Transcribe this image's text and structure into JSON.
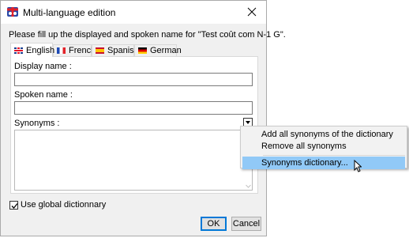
{
  "window": {
    "title": "Multi-language edition",
    "instruction": "Please fill up the displayed and spoken name for \"Test coût com N-1 G\"."
  },
  "tabs": [
    {
      "label": "English",
      "flag": "uk",
      "active": true
    },
    {
      "label": "French",
      "flag": "fr",
      "active": false
    },
    {
      "label": "Spanish",
      "flag": "es",
      "active": false
    },
    {
      "label": "German",
      "flag": "de",
      "active": false
    }
  ],
  "form": {
    "display_name_label": "Display name :",
    "display_name_value": "",
    "spoken_name_label": "Spoken name :",
    "spoken_name_value": "",
    "synonyms_label": "Synonyms :",
    "synonyms_value": ""
  },
  "checkbox": {
    "label": "Use global dictionnary",
    "checked": true
  },
  "buttons": {
    "ok": "OK",
    "cancel": "Cancel"
  },
  "context_menu": {
    "items": [
      {
        "label": "Add all synonyms of the dictionary",
        "highlighted": false
      },
      {
        "label": "Remove all synonyms",
        "highlighted": false
      },
      {
        "label": "Synonyms dictionary...",
        "highlighted": true
      }
    ]
  },
  "colors": {
    "accent": "#0078d7",
    "menu_highlight": "#91c9f7"
  }
}
